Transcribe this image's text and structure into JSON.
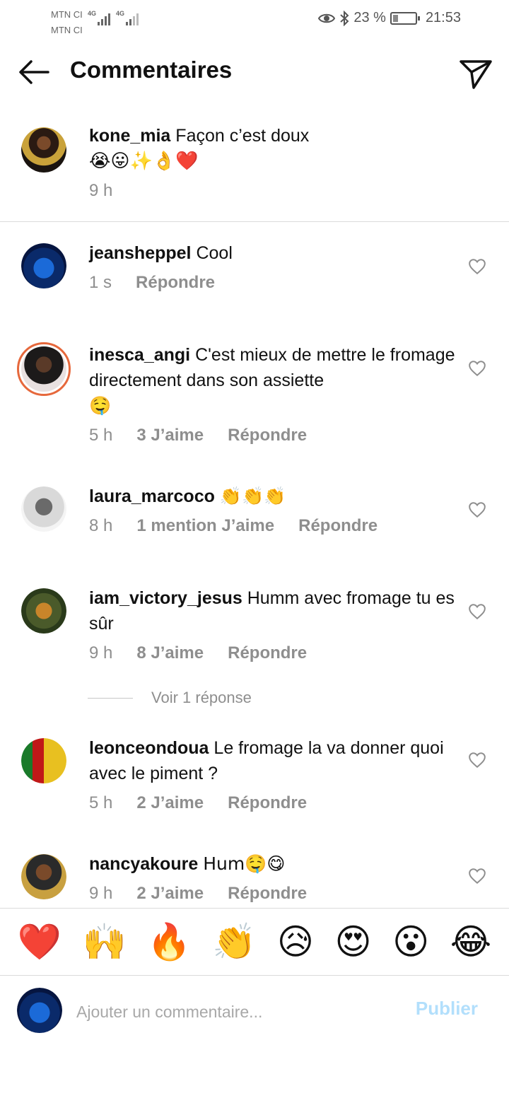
{
  "status": {
    "carrier1": "MTN CI",
    "carrier2": "MTN CI",
    "net_label": "4G",
    "battery_text": "23 %",
    "battery_level": 0.23,
    "time": "21:53"
  },
  "header": {
    "title": "Commentaires"
  },
  "caption": {
    "username": "kone_mia",
    "text": "Façon c’est doux",
    "emojis": "😭😛✨👌❤️",
    "time": "9 h"
  },
  "comments": [
    {
      "username": "jeansheppel",
      "text": "Cool",
      "time": "1 s",
      "likes": "",
      "reply": "Répondre"
    },
    {
      "username": "inesca_angi",
      "text": "C'est mieux de mettre le fromage directement dans son assiette",
      "emoji": "🤤",
      "time": "5 h",
      "likes": "3 J’aime",
      "reply": "Répondre"
    },
    {
      "username": "laura_marcoco",
      "text": "👏👏👏",
      "time": "8 h",
      "likes": "1 mention J’aime",
      "reply": "Répondre"
    },
    {
      "username": "iam_victory_jesus",
      "text": "Humm avec fromage tu es sûr",
      "time": "9 h",
      "likes": "8 J’aime",
      "reply": "Répondre"
    },
    {
      "username": "leonceondoua",
      "text": "Le fromage la va donner quoi avec le piment ?",
      "time": "5 h",
      "likes": "2 J’aime",
      "reply": "Répondre"
    },
    {
      "username": "nancyakoure",
      "text": "Hum🤤😋",
      "time": "9 h",
      "likes": "2 J’aime",
      "reply": "Répondre"
    }
  ],
  "view_replies": "Voir 1 réponse",
  "emoji_bar": [
    "❤️",
    "🙌",
    "🔥",
    "👏",
    "😥",
    "😍",
    "😮",
    "😂"
  ],
  "composer": {
    "placeholder": "Ajouter un commentaire...",
    "publish": "Publier"
  },
  "colors": {
    "accent": "#0095f6",
    "publish_disabled": "#b2dffc",
    "muted": "#8e8e8e"
  }
}
